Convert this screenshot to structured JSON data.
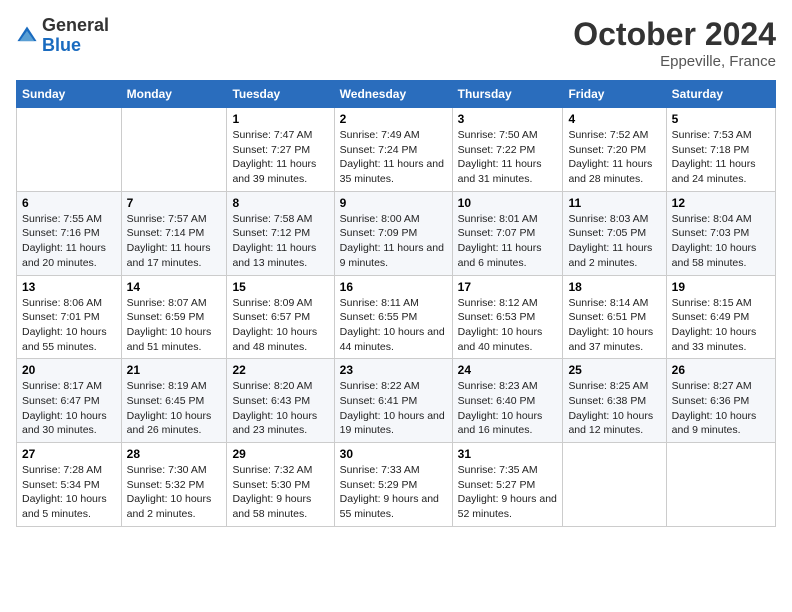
{
  "logo": {
    "general": "General",
    "blue": "Blue"
  },
  "header": {
    "month_year": "October 2024",
    "location": "Eppeville, France"
  },
  "days_of_week": [
    "Sunday",
    "Monday",
    "Tuesday",
    "Wednesday",
    "Thursday",
    "Friday",
    "Saturday"
  ],
  "weeks": [
    [
      {
        "day": "",
        "content": ""
      },
      {
        "day": "",
        "content": ""
      },
      {
        "day": "1",
        "content": "Sunrise: 7:47 AM\nSunset: 7:27 PM\nDaylight: 11 hours and 39 minutes."
      },
      {
        "day": "2",
        "content": "Sunrise: 7:49 AM\nSunset: 7:24 PM\nDaylight: 11 hours and 35 minutes."
      },
      {
        "day": "3",
        "content": "Sunrise: 7:50 AM\nSunset: 7:22 PM\nDaylight: 11 hours and 31 minutes."
      },
      {
        "day": "4",
        "content": "Sunrise: 7:52 AM\nSunset: 7:20 PM\nDaylight: 11 hours and 28 minutes."
      },
      {
        "day": "5",
        "content": "Sunrise: 7:53 AM\nSunset: 7:18 PM\nDaylight: 11 hours and 24 minutes."
      }
    ],
    [
      {
        "day": "6",
        "content": "Sunrise: 7:55 AM\nSunset: 7:16 PM\nDaylight: 11 hours and 20 minutes."
      },
      {
        "day": "7",
        "content": "Sunrise: 7:57 AM\nSunset: 7:14 PM\nDaylight: 11 hours and 17 minutes."
      },
      {
        "day": "8",
        "content": "Sunrise: 7:58 AM\nSunset: 7:12 PM\nDaylight: 11 hours and 13 minutes."
      },
      {
        "day": "9",
        "content": "Sunrise: 8:00 AM\nSunset: 7:09 PM\nDaylight: 11 hours and 9 minutes."
      },
      {
        "day": "10",
        "content": "Sunrise: 8:01 AM\nSunset: 7:07 PM\nDaylight: 11 hours and 6 minutes."
      },
      {
        "day": "11",
        "content": "Sunrise: 8:03 AM\nSunset: 7:05 PM\nDaylight: 11 hours and 2 minutes."
      },
      {
        "day": "12",
        "content": "Sunrise: 8:04 AM\nSunset: 7:03 PM\nDaylight: 10 hours and 58 minutes."
      }
    ],
    [
      {
        "day": "13",
        "content": "Sunrise: 8:06 AM\nSunset: 7:01 PM\nDaylight: 10 hours and 55 minutes."
      },
      {
        "day": "14",
        "content": "Sunrise: 8:07 AM\nSunset: 6:59 PM\nDaylight: 10 hours and 51 minutes."
      },
      {
        "day": "15",
        "content": "Sunrise: 8:09 AM\nSunset: 6:57 PM\nDaylight: 10 hours and 48 minutes."
      },
      {
        "day": "16",
        "content": "Sunrise: 8:11 AM\nSunset: 6:55 PM\nDaylight: 10 hours and 44 minutes."
      },
      {
        "day": "17",
        "content": "Sunrise: 8:12 AM\nSunset: 6:53 PM\nDaylight: 10 hours and 40 minutes."
      },
      {
        "day": "18",
        "content": "Sunrise: 8:14 AM\nSunset: 6:51 PM\nDaylight: 10 hours and 37 minutes."
      },
      {
        "day": "19",
        "content": "Sunrise: 8:15 AM\nSunset: 6:49 PM\nDaylight: 10 hours and 33 minutes."
      }
    ],
    [
      {
        "day": "20",
        "content": "Sunrise: 8:17 AM\nSunset: 6:47 PM\nDaylight: 10 hours and 30 minutes."
      },
      {
        "day": "21",
        "content": "Sunrise: 8:19 AM\nSunset: 6:45 PM\nDaylight: 10 hours and 26 minutes."
      },
      {
        "day": "22",
        "content": "Sunrise: 8:20 AM\nSunset: 6:43 PM\nDaylight: 10 hours and 23 minutes."
      },
      {
        "day": "23",
        "content": "Sunrise: 8:22 AM\nSunset: 6:41 PM\nDaylight: 10 hours and 19 minutes."
      },
      {
        "day": "24",
        "content": "Sunrise: 8:23 AM\nSunset: 6:40 PM\nDaylight: 10 hours and 16 minutes."
      },
      {
        "day": "25",
        "content": "Sunrise: 8:25 AM\nSunset: 6:38 PM\nDaylight: 10 hours and 12 minutes."
      },
      {
        "day": "26",
        "content": "Sunrise: 8:27 AM\nSunset: 6:36 PM\nDaylight: 10 hours and 9 minutes."
      }
    ],
    [
      {
        "day": "27",
        "content": "Sunrise: 7:28 AM\nSunset: 5:34 PM\nDaylight: 10 hours and 5 minutes."
      },
      {
        "day": "28",
        "content": "Sunrise: 7:30 AM\nSunset: 5:32 PM\nDaylight: 10 hours and 2 minutes."
      },
      {
        "day": "29",
        "content": "Sunrise: 7:32 AM\nSunset: 5:30 PM\nDaylight: 9 hours and 58 minutes."
      },
      {
        "day": "30",
        "content": "Sunrise: 7:33 AM\nSunset: 5:29 PM\nDaylight: 9 hours and 55 minutes."
      },
      {
        "day": "31",
        "content": "Sunrise: 7:35 AM\nSunset: 5:27 PM\nDaylight: 9 hours and 52 minutes."
      },
      {
        "day": "",
        "content": ""
      },
      {
        "day": "",
        "content": ""
      }
    ]
  ]
}
